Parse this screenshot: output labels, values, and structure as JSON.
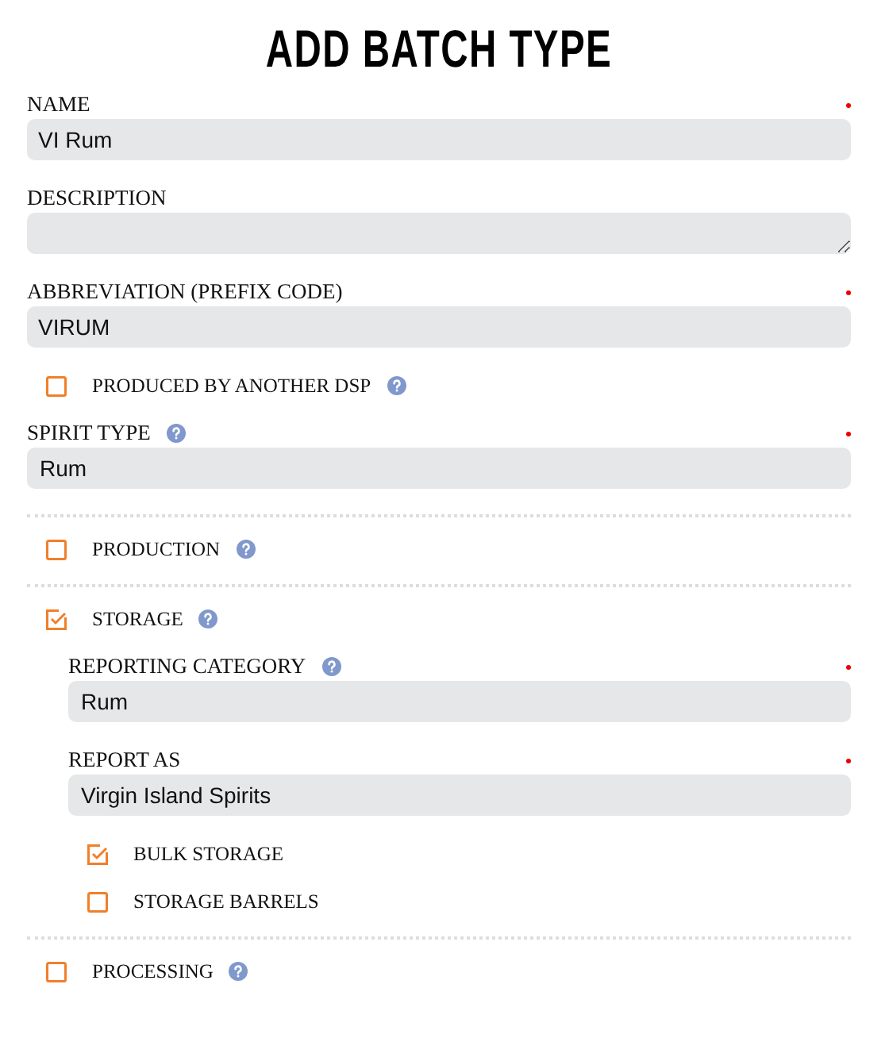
{
  "title": "ADD BATCH TYPE",
  "items": [
    {
      "kind": "text",
      "label": "NAME",
      "required": true,
      "value": "VI Rum"
    },
    {
      "kind": "textarea",
      "label": "DESCRIPTION",
      "required": false
    },
    {
      "kind": "text",
      "label": "ABBREVIATION (PREFIX CODE)",
      "required": true,
      "value": "VIRUM"
    },
    {
      "kind": "checkbox",
      "label": "PRODUCED BY ANOTHER DSP",
      "checked": false,
      "help": true
    },
    {
      "kind": "select",
      "label": "SPIRIT TYPE",
      "help": true,
      "required": true,
      "value": "Rum"
    },
    {
      "kind": "divider"
    },
    {
      "kind": "checkbox",
      "label": "PRODUCTION",
      "checked": false,
      "help": true
    },
    {
      "kind": "divider"
    },
    {
      "kind": "checkbox",
      "label": "STORAGE",
      "checked": true,
      "help": true,
      "children": [
        {
          "kind": "select",
          "label": "REPORTING CATEGORY",
          "help": true,
          "required": true,
          "value": "Rum"
        },
        {
          "kind": "select",
          "label": "REPORT AS",
          "required": true,
          "value": "Virgin Island Spirits"
        },
        {
          "kind": "checkbox",
          "label": "BULK STORAGE",
          "checked": true
        },
        {
          "kind": "checkbox",
          "label": "STORAGE BARRELS",
          "checked": false
        }
      ]
    },
    {
      "kind": "divider"
    },
    {
      "kind": "checkbox",
      "label": "PROCESSING",
      "checked": false,
      "help": true
    }
  ]
}
